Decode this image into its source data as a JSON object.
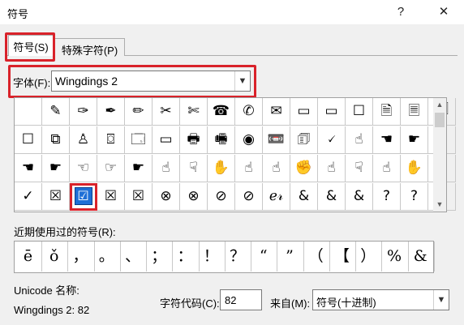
{
  "window": {
    "title": "符号",
    "help_glyph": "?",
    "close_glyph": "✕"
  },
  "tabs": [
    {
      "label": "符号(S)",
      "active": true
    },
    {
      "label": "特殊字符(P)",
      "active": false
    }
  ],
  "font": {
    "label": "字体(F):",
    "value": "Wingdings 2"
  },
  "grid": {
    "rows": [
      [
        "",
        "✎",
        "✑",
        "✒",
        "✏",
        "✂",
        "✄",
        "☎",
        "✆",
        "✉",
        "▭",
        "▭",
        "☐",
        "🗎",
        "🗏",
        "🗐"
      ],
      [
        "☐",
        "⧉",
        "♙",
        "⌼",
        "🗔",
        "▭",
        "🖶",
        "🖷",
        "◉",
        "📼",
        "🗊",
        "🗸",
        "☝",
        "☚",
        "☛",
        "☜"
      ],
      [
        "☚",
        "☛",
        "☜",
        "☞",
        "☛",
        "☝",
        "☟",
        "✋",
        "☝",
        "☝",
        "✊",
        "☝",
        "☟",
        "☝",
        "✋",
        "✕"
      ],
      [
        "✓",
        "☒",
        "☑",
        "☒",
        "☒",
        "⊗",
        "⊗",
        "⊘",
        "⊘",
        "ℯ𝓇",
        "&",
        "&",
        "&",
        "?",
        "?",
        "?"
      ]
    ],
    "selected": {
      "row": 3,
      "col": 2
    }
  },
  "recent": {
    "label": "近期使用过的符号(R):",
    "symbols": [
      "ē",
      "ǒ",
      "，",
      "。",
      "、",
      "；",
      "：",
      "！",
      "？",
      "“",
      "”",
      "（",
      "【",
      "）",
      "%",
      "&"
    ]
  },
  "unicode": {
    "label": "Unicode 名称:",
    "value": "Wingdings 2: 82"
  },
  "char_code": {
    "label": "字符代码(C):",
    "value": "82"
  },
  "from": {
    "label": "来自(M):",
    "value": "符号(十进制)"
  }
}
